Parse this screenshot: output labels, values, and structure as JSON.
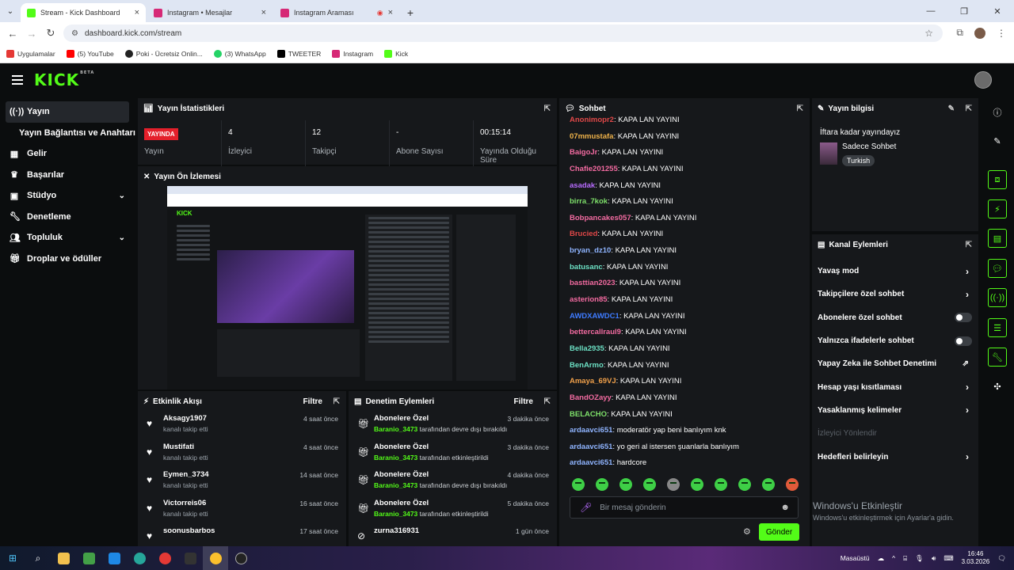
{
  "browser": {
    "tabs": [
      {
        "title": "Stream - Kick Dashboard",
        "active": true,
        "favicon_color": "#53fc18"
      },
      {
        "title": "Instagram • Mesajlar",
        "active": false,
        "favicon_color": "#d62976"
      },
      {
        "title": "Instagram Araması",
        "active": false,
        "favicon_color": "#d62976"
      }
    ],
    "url": "dashboard.kick.com/stream",
    "bookmarks": [
      {
        "label": "Uygulamalar",
        "icon_color": "#e53935"
      },
      {
        "label": "(5) YouTube",
        "icon_color": "#ff0000"
      },
      {
        "label": "Poki - Ücretsiz Onlin...",
        "icon_color": "#222222"
      },
      {
        "label": "(3) WhatsApp",
        "icon_color": "#25d366"
      },
      {
        "label": "TWEETER",
        "icon_color": "#000000"
      },
      {
        "label": "Instagram",
        "icon_color": "#d62976"
      },
      {
        "label": "Kick",
        "icon_color": "#53fc18"
      }
    ]
  },
  "nav": {
    "items": [
      {
        "label": "Yayın",
        "icon": "stream-icon",
        "active": true
      },
      {
        "label": "Yayın Bağlantısı ve Anahtarı",
        "sub": true
      },
      {
        "label": "Gelir",
        "icon": "chart-icon"
      },
      {
        "label": "Başarılar",
        "icon": "trophy-icon"
      },
      {
        "label": "Stüdyo",
        "icon": "studio-icon",
        "expandable": true
      },
      {
        "label": "Denetleme",
        "icon": "wrench-icon"
      },
      {
        "label": "Topluluk",
        "icon": "people-icon",
        "expandable": true
      },
      {
        "label": "Droplar ve ödüller",
        "icon": "gift-icon"
      }
    ]
  },
  "stats": {
    "title": "Yayın İstatistikleri",
    "live_badge": "YAYINDA",
    "items": [
      {
        "value": "",
        "label": "Yayın"
      },
      {
        "value": "4",
        "label": "İzleyici"
      },
      {
        "value": "12",
        "label": "Takipçi"
      },
      {
        "value": "-",
        "label": "Abone Sayısı"
      },
      {
        "value": "00:15:14",
        "label": "Yayında Olduğu Süre"
      }
    ]
  },
  "preview": {
    "title": "Yayın Ön İzlemesi"
  },
  "activity": {
    "title": "Etkinlik Akışı",
    "filter": "Filtre",
    "items": [
      {
        "name": "Aksagy1907",
        "desc": "kanalı takip etti",
        "time": "4 saat önce"
      },
      {
        "name": "Mustifati",
        "desc": "kanalı takip etti",
        "time": "4 saat önce"
      },
      {
        "name": "Eymen_3734",
        "desc": "kanalı takip etti",
        "time": "14 saat önce"
      },
      {
        "name": "Victorreis06",
        "desc": "kanalı takip etti",
        "time": "16 saat önce"
      },
      {
        "name": "soonusbarbos",
        "desc": "",
        "time": "17 saat önce"
      }
    ]
  },
  "moderation": {
    "title": "Denetim Eylemleri",
    "filter": "Filtre",
    "items": [
      {
        "name": "Abonelere Özel",
        "user": "Baranio_3473",
        "desc": " tarafından devre dışı bırakıldı",
        "time": "3 dakika önce"
      },
      {
        "name": "Abonelere Özel",
        "user": "Baranio_3473",
        "desc": " tarafından etkinleştirildi",
        "time": "3 dakika önce"
      },
      {
        "name": "Abonelere Özel",
        "user": "Baranio_3473",
        "desc": " tarafından devre dışı bırakıldı",
        "time": "4 dakika önce"
      },
      {
        "name": "Abonelere Özel",
        "user": "Baranio_3473",
        "desc": " tarafından etkinleştirildi",
        "time": "5 dakika önce"
      },
      {
        "name": "zurna316931",
        "user": "",
        "desc": "",
        "time": "1 gün önce"
      }
    ]
  },
  "chat": {
    "title": "Sohbet",
    "messages": [
      {
        "user": "Anonimopr2",
        "color": "#e04848",
        "text": "KAPA LAN YAYINI"
      },
      {
        "user": "07mmustafa",
        "color": "#f0b34a",
        "text": "KAPA LAN YAYINI"
      },
      {
        "user": "BaigoJr",
        "color": "#f36ba1",
        "text": "KAPA LAN YAYINI"
      },
      {
        "user": "Chafie201255",
        "color": "#f36ba1",
        "text": "KAPA LAN YAYINI"
      },
      {
        "user": "asadak",
        "color": "#b86cff",
        "text": "KAPA LAN YAYINI"
      },
      {
        "user": "birra_7kok",
        "color": "#7ee06a",
        "text": "KAPA LAN YAYINI"
      },
      {
        "user": "Bobpancakes057",
        "color": "#f36ba1",
        "text": "KAPA LAN YAYINI"
      },
      {
        "user": "Brucied",
        "color": "#e04848",
        "text": "KAPA LAN YAYINI"
      },
      {
        "user": "bryan_dz10",
        "color": "#8fb4ff",
        "text": "KAPA LAN YAYINI"
      },
      {
        "user": "batusanc",
        "color": "#6ce0c4",
        "text": "KAPA LAN YAYINI"
      },
      {
        "user": "basttian2023",
        "color": "#f36ba1",
        "text": "KAPA LAN YAYINI"
      },
      {
        "user": "asterion85",
        "color": "#f36ba1",
        "text": "KAPA LAN YAYINI"
      },
      {
        "user": "AWDXAWDC1",
        "color": "#3e7bff",
        "text": "KAPA LAN YAYINI"
      },
      {
        "user": "bettercallraul9",
        "color": "#f36ba1",
        "text": "KAPA LAN YAYINI"
      },
      {
        "user": "Bella2935",
        "color": "#6ce0c4",
        "text": "KAPA LAN YAYINI"
      },
      {
        "user": "BenArmo",
        "color": "#6ce0c4",
        "text": "KAPA LAN YAYINI"
      },
      {
        "user": "Amaya_69VJ",
        "color": "#f0a04a",
        "text": "KAPA LAN YAYINI"
      },
      {
        "user": "BandOZayy",
        "color": "#f36ba1",
        "text": "KAPA LAN YAYINI"
      },
      {
        "user": "BELACHO",
        "color": "#7ee06a",
        "text": "KAPA LAN YAYINI"
      },
      {
        "user": "ardaavci651",
        "color": "#8fb4ff",
        "text": "moderatör yap beni banlıyım knk"
      },
      {
        "user": "ardaavci651",
        "color": "#8fb4ff",
        "text": "yo geri al istersen şuanlarla banlıyım"
      },
      {
        "user": "ardaavci651",
        "color": "#8fb4ff",
        "text": "hardcore"
      }
    ],
    "placeholder": "Bir mesaj gönderin",
    "send_label": "Gönder"
  },
  "stream_info": {
    "title": "Yayın bilgisi",
    "stream_title": "İftara kadar yayındayız",
    "category": "Sadece Sohbet",
    "tag": "Turkish"
  },
  "channel_actions": {
    "title": "Kanal Eylemleri",
    "items": [
      {
        "label": "Yavaş mod",
        "control": "chevron"
      },
      {
        "label": "Takipçilere özel sohbet",
        "control": "chevron"
      },
      {
        "label": "Abonelere özel sohbet",
        "control": "toggle"
      },
      {
        "label": "Yalnızca ifadelerle sohbet",
        "control": "toggle"
      },
      {
        "label": "Yapay Zeka ile Sohbet Denetimi",
        "control": "external"
      },
      {
        "label": "Hesap yaşı kısıtlaması",
        "control": "chevron"
      },
      {
        "label": "Yasaklanmış kelimeler",
        "control": "chevron"
      },
      {
        "label": "İzleyici Yönlendir",
        "control": "none",
        "disabled": true
      },
      {
        "label": "Hedefleri belirleyin",
        "control": "chevron"
      }
    ]
  },
  "watermark": {
    "title": "Windows'u Etkinleştir",
    "subtitle": "Windows'u etkinleştirmek için Ayarlar'a gidin."
  },
  "taskbar": {
    "desktop_label": "Masaüstü",
    "time": "16:46",
    "date": "3.03.2026"
  },
  "colors": {
    "accent": "#53fc18",
    "live": "#e4202b"
  }
}
